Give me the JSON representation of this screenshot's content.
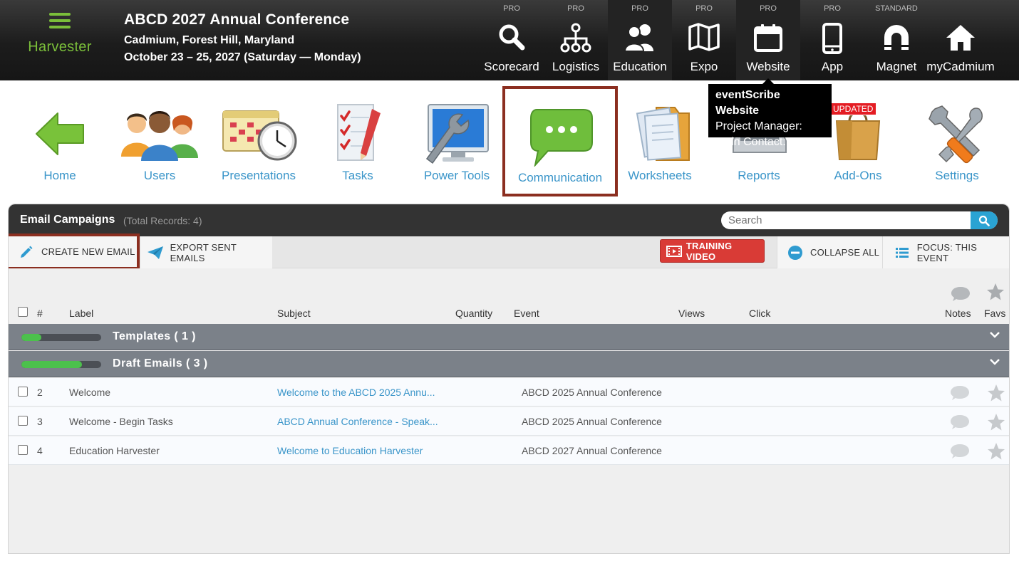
{
  "brand": {
    "name": "Harvester"
  },
  "event": {
    "title": "ABCD 2027 Annual Conference",
    "location": "Cadmium, Forest Hill, Maryland",
    "dates": "October 23 – 25, 2027 (Saturday — Monday)"
  },
  "topnav": [
    {
      "tier": "PRO",
      "label": "Scorecard",
      "icon": "search-icon"
    },
    {
      "tier": "PRO",
      "label": "Logistics",
      "icon": "sitemap-icon"
    },
    {
      "tier": "PRO",
      "label": "Education",
      "icon": "users-icon"
    },
    {
      "tier": "PRO",
      "label": "Expo",
      "icon": "map-icon"
    },
    {
      "tier": "PRO",
      "label": "Website",
      "icon": "calendar-icon"
    },
    {
      "tier": "PRO",
      "label": "App",
      "icon": "mobile-icon"
    },
    {
      "tier": "STANDARD",
      "label": "Magnet",
      "icon": "magnet-icon"
    },
    {
      "tier": "",
      "label": "myCadmium",
      "icon": "home-icon"
    }
  ],
  "tooltip": {
    "title": "eventScribe Website",
    "line1": "Project Manager:",
    "line2": "Main Contact:"
  },
  "modules": [
    {
      "label": "Home",
      "icon": "back-arrow-icon"
    },
    {
      "label": "Users",
      "icon": "people-icon"
    },
    {
      "label": "Presentations",
      "icon": "calendar-clock-icon"
    },
    {
      "label": "Tasks",
      "icon": "checklist-icon"
    },
    {
      "label": "Power Tools",
      "icon": "monitor-wrench-icon"
    },
    {
      "label": "Communication",
      "icon": "chat-bubble-icon"
    },
    {
      "label": "Worksheets",
      "icon": "folder-icon"
    },
    {
      "label": "Reports",
      "icon": "printer-icon"
    },
    {
      "label": "Add-Ons",
      "icon": "shopping-bag-icon",
      "badge": "UPDATED"
    },
    {
      "label": "Settings",
      "icon": "tools-icon"
    }
  ],
  "panel": {
    "title": "Email Campaigns",
    "count": "(Total Records: 4)",
    "search_placeholder": "Search"
  },
  "toolbar": {
    "create": "CREATE NEW EMAIL",
    "export": "EXPORT SENT EMAILS",
    "training": "TRAINING VIDEO",
    "collapse": "COLLAPSE ALL",
    "focus": "FOCUS: THIS EVENT"
  },
  "columns": {
    "num": "#",
    "label": "Label",
    "subject": "Subject",
    "quantity": "Quantity",
    "event": "Event",
    "views": "Views",
    "click": "Click",
    "notes": "Notes",
    "favs": "Favs"
  },
  "groups": [
    {
      "title": "Templates   ( 1 )",
      "progress": 0.25
    },
    {
      "title": "Draft Emails   ( 3 )",
      "progress": 0.76
    }
  ],
  "rows": [
    {
      "num": "2",
      "label": "Welcome",
      "subject": "Welcome to the ABCD 2025 Annu...",
      "event": "ABCD 2025 Annual Conference"
    },
    {
      "num": "3",
      "label": "Welcome - Begin Tasks",
      "subject": "ABCD Annual Conference - Speak...",
      "event": "ABCD 2025 Annual Conference"
    },
    {
      "num": "4",
      "label": "Education Harvester",
      "subject": "Welcome to Education Harvester",
      "event": "ABCD 2027 Annual Conference"
    }
  ],
  "colors": {
    "brand_green": "#7bbf3a",
    "link_blue": "#3a95c9",
    "highlight": "#8b2e20",
    "training_red": "#d93b36",
    "group_gray": "#7b8189"
  }
}
